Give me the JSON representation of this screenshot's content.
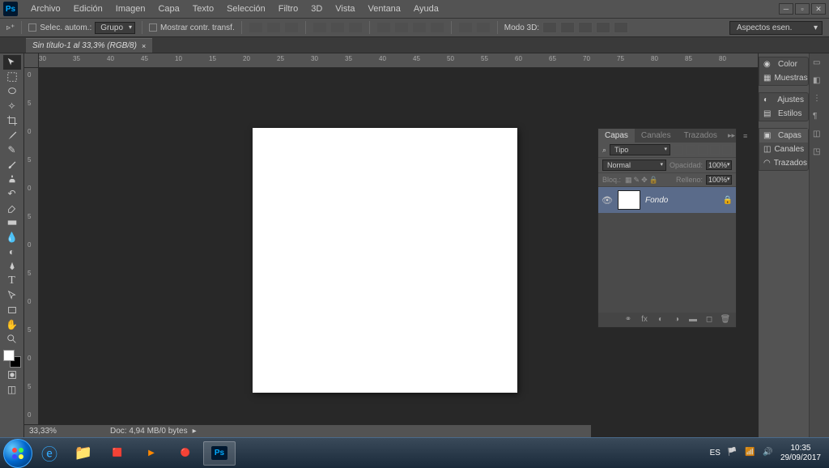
{
  "menubar": {
    "items": [
      "Archivo",
      "Edición",
      "Imagen",
      "Capa",
      "Texto",
      "Selección",
      "Filtro",
      "3D",
      "Vista",
      "Ventana",
      "Ayuda"
    ]
  },
  "optbar": {
    "auto_select": "Selec. autom.:",
    "group": "Grupo",
    "show_transform": "Mostrar contr. transf.",
    "mode3d": "Modo 3D:",
    "essentials": "Aspectos esen."
  },
  "doctab": {
    "title": "Sin título-1 al 33,3% (RGB/8)"
  },
  "ruler_h": [
    "30",
    "35",
    "40",
    "45",
    "10",
    "15",
    "20",
    "25",
    "30",
    "35",
    "40",
    "45",
    "50",
    "55",
    "60",
    "65",
    "70",
    "75",
    "80",
    "85",
    "80"
  ],
  "ruler_v": [
    "0",
    "5",
    "0",
    "5",
    "0",
    "5",
    "0",
    "5",
    "0",
    "5",
    "0",
    "5",
    "0"
  ],
  "collapsed": {
    "color": "Color",
    "muestras": "Muestras",
    "ajustes": "Ajustes",
    "estilos": "Estilos",
    "capas": "Capas",
    "canales": "Canales",
    "trazados": "Trazados"
  },
  "layers": {
    "tab_capas": "Capas",
    "tab_canales": "Canales",
    "tab_trazados": "Trazados",
    "kind_label": "Tipo",
    "mode": "Normal",
    "opacity_label": "Opacidad:",
    "opacity_value": "100%",
    "lock_label": "Bloq.:",
    "fill_label": "Relleno:",
    "fill_value": "100%",
    "layer_name": "Fondo"
  },
  "status": {
    "zoom": "33,33%",
    "doc": "Doc: 4,94 MB/0 bytes"
  },
  "taskbar": {
    "lang": "ES",
    "time": "10:35",
    "date": "29/09/2017"
  }
}
